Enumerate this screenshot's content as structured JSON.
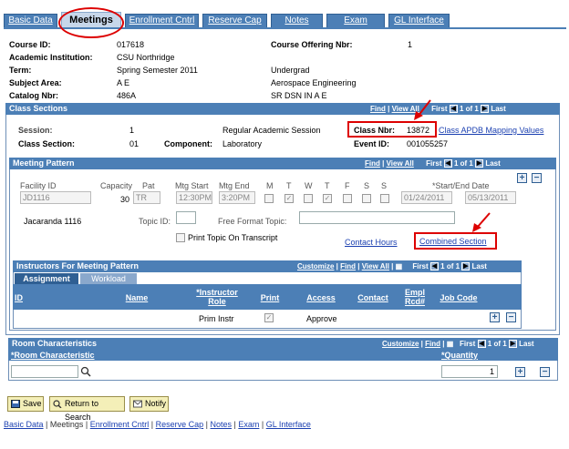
{
  "tabs": [
    "Basic Data",
    "Meetings",
    "Enrollment Cntrl",
    "Reserve Cap",
    "Notes",
    "Exam",
    "GL Interface"
  ],
  "course": {
    "course_id_label": "Course ID:",
    "course_id": "017618",
    "institution_label": "Academic Institution:",
    "institution": "CSU Northridge",
    "term_label": "Term:",
    "term": "Spring Semester 2011",
    "career": "Undergrad",
    "subject_label": "Subject Area:",
    "subject": "A E",
    "subject_desc": "Aerospace Engineering",
    "catalog_label": "Catalog Nbr:",
    "catalog": "486A",
    "catalog_desc": "SR DSN IN A E",
    "offering_label": "Course Offering Nbr:",
    "offering": "1"
  },
  "class_sections": {
    "title": "Class Sections",
    "find": "Find",
    "view_all": "View All",
    "first": "First",
    "pos": "1 of 1",
    "last": "Last",
    "session_label": "Session:",
    "session": "1",
    "session_desc": "Regular Academic Session",
    "class_nbr_label": "Class Nbr:",
    "class_nbr": "13872",
    "apdb_link": "Class APDB Mapping Values",
    "class_section_label": "Class Section:",
    "class_section": "01",
    "component_label": "Component:",
    "component": "Laboratory",
    "event_label": "Event ID:",
    "event_id": "001055257"
  },
  "meeting_pattern": {
    "title": "Meeting Pattern",
    "find": "Find",
    "view_all": "View All",
    "first": "First",
    "pos": "1 of 1",
    "last": "Last",
    "cols": {
      "facility": "Facility ID",
      "capacity": "Capacity",
      "pat": "Pat",
      "mtg_start": "Mtg Start",
      "mtg_end": "Mtg End",
      "m": "M",
      "t": "T",
      "w": "W",
      "th": "T",
      "f": "F",
      "s": "S",
      "su": "S",
      "dates": "*Start/End Date"
    },
    "facility": "JD1116",
    "capacity": "30",
    "pat": "TR",
    "start": "12:30PM",
    "end": "3:20PM",
    "start_date": "01/24/2011",
    "end_date": "05/13/2011",
    "facility_desc": "Jacaranda  1116",
    "topic_label": "Topic ID:",
    "free_topic_label": "Free Format Topic:",
    "print_topic_label": "Print Topic On Transcript",
    "contact_hours": "Contact Hours",
    "combined_section": "Combined Section"
  },
  "instructors": {
    "title": "Instructors For Meeting Pattern",
    "customize": "Customize",
    "find": "Find",
    "view_all": "View All",
    "first": "First",
    "pos": "1 of 1",
    "last": "Last",
    "tab_assignment": "Assignment",
    "tab_workload": "Workload",
    "cols": {
      "id": "ID",
      "name": "Name",
      "role": "*Instructor Role",
      "print": "Print",
      "access": "Access",
      "contact": "Contact",
      "empl_rcd": "Empl Rcd#",
      "job_code": "Job Code"
    },
    "row": {
      "role": "Prim Instr",
      "access": "Approve"
    }
  },
  "room": {
    "title": "Room Characteristics",
    "customize": "Customize",
    "find": "Find",
    "first": "First",
    "pos": "1 of 1",
    "last": "Last",
    "col_room": "*Room Characteristic",
    "col_qty": "*Quantity",
    "qty": "1"
  },
  "buttons": {
    "save": "Save",
    "return": "Return to Search",
    "notify": "Notify"
  },
  "footer": [
    "Basic Data",
    "Meetings",
    "Enrollment Cntrl",
    "Reserve Cap",
    "Notes",
    "Exam",
    "GL Interface"
  ]
}
